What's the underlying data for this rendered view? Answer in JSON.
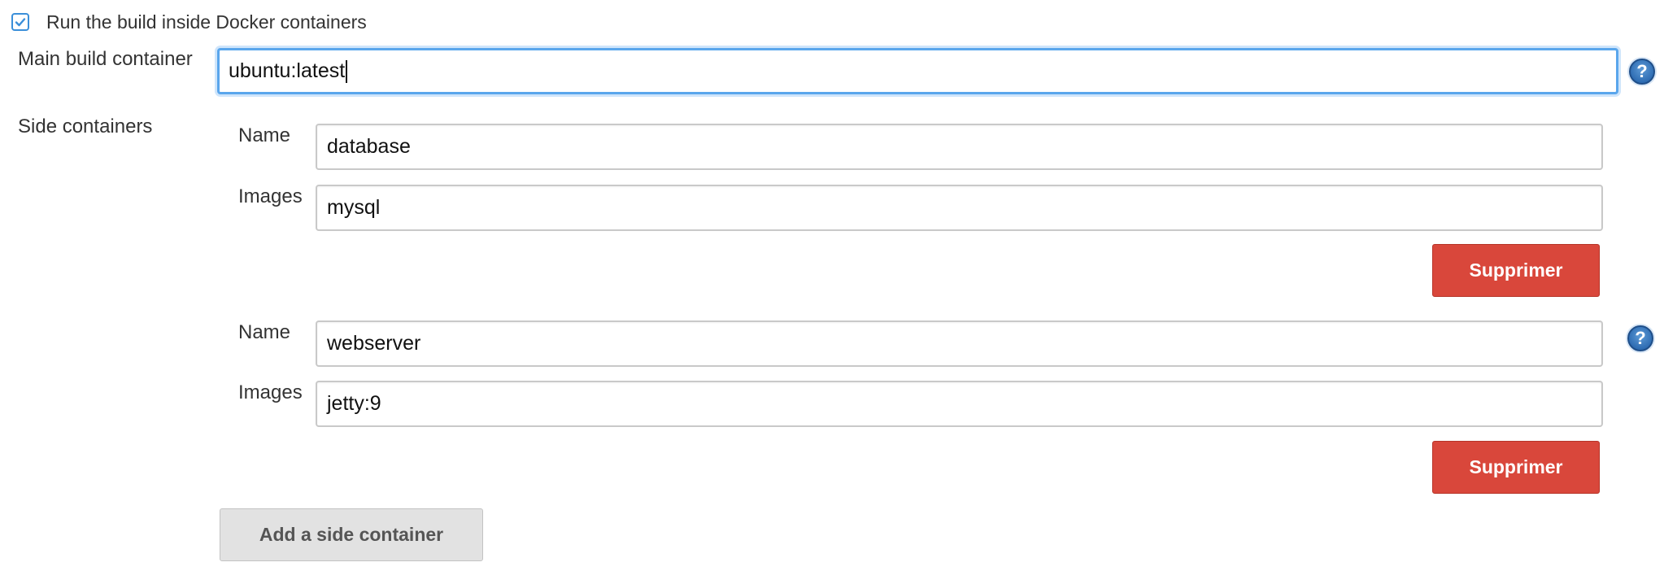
{
  "docker": {
    "run_inside_label": "Run the build inside Docker containers",
    "run_inside_checked": true
  },
  "main_container": {
    "label": "Main build container",
    "value": "ubuntu:latest"
  },
  "side_containers": {
    "label": "Side containers",
    "items": [
      {
        "name_label": "Name",
        "name_value": "database",
        "images_label": "Images",
        "images_value": "mysql",
        "delete_label": "Supprimer"
      },
      {
        "name_label": "Name",
        "name_value": "webserver",
        "images_label": "Images",
        "images_value": "jetty:9",
        "delete_label": "Supprimer"
      }
    ],
    "add_label": "Add a side container"
  },
  "help_icon": {
    "glyph": "?"
  },
  "colors": {
    "accent": "#3b8fd9",
    "focus_border": "#5aa6ec",
    "danger": "#d9473b",
    "help_blue": "#2f6db3",
    "neutral_button": "#e2e2e2"
  }
}
